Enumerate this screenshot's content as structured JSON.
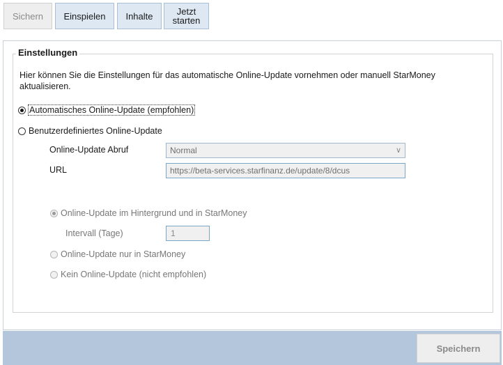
{
  "toolbar": {
    "sichern_label": "Sichern",
    "einspielen_label": "Einspielen",
    "inhalte_label": "Inhalte",
    "jetzt_starten_label": "Jetzt starten"
  },
  "settings": {
    "legend": "Einstellungen",
    "description": "Hier können Sie die Einstellungen für das automatische Online-Update vornehmen oder manuell StarMoney aktualisieren.",
    "radio_auto": "Automatisches Online-Update (empfohlen)",
    "radio_custom": "Benutzerdefiniertes Online-Update",
    "abruf_label": "Online-Update Abruf",
    "abruf_value": "Normal",
    "url_label": "URL",
    "url_value": "https://beta-services.starfinanz.de/update/8/dcus",
    "option_background": "Online-Update im Hintergrund und in StarMoney",
    "interval_label": "Intervall (Tage)",
    "interval_value": "1",
    "option_only_starmoney": "Online-Update nur in StarMoney",
    "option_none": "Kein Online-Update (nicht empfohlen)"
  },
  "footer": {
    "save_label": "Speichern"
  },
  "icons": {
    "dropdown": "chevron-down-icon"
  }
}
